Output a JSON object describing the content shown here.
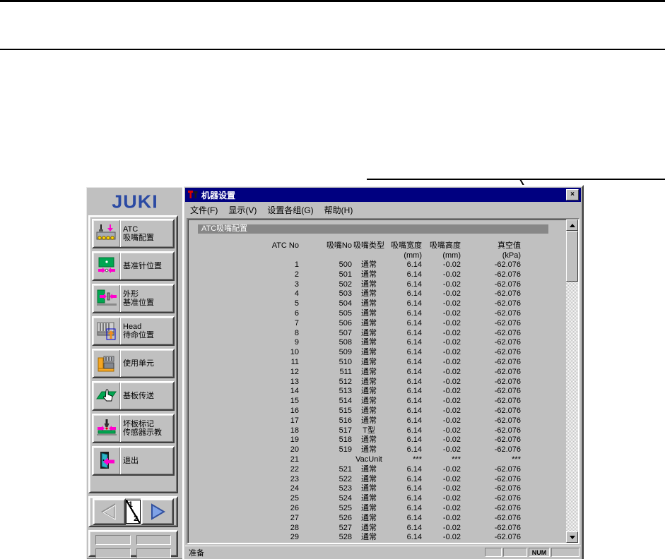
{
  "sidebar": {
    "logo": "JUKI",
    "buttons": [
      {
        "line1": "ATC",
        "line2": "吸嘴配置"
      },
      {
        "line1": "基准针位置",
        "line2": ""
      },
      {
        "line1": "外形",
        "line2": "基准位置"
      },
      {
        "line1": "Head",
        "line2": "待命位置"
      },
      {
        "line1": "使用单元",
        "line2": ""
      },
      {
        "line1": "基板传送",
        "line2": ""
      },
      {
        "line1": "坏板标记",
        "line2": "传感器示教"
      },
      {
        "line1": "退出",
        "line2": ""
      }
    ],
    "pager": {
      "current": "1",
      "total": "2"
    }
  },
  "window": {
    "title": "机器设置",
    "close_glyph": "×",
    "menu": [
      "文件(F)",
      "显示(V)",
      "设置各组(G)",
      "帮助(H)"
    ],
    "section_header": "ATC吸嘴配置",
    "table": {
      "headers": [
        "ATC No",
        "吸嘴No",
        "吸嘴类型",
        "吸嘴宽度",
        "吸嘴高度",
        "真空值"
      ],
      "units": [
        "",
        "",
        "",
        "(mm)",
        "(mm)",
        "(kPa)"
      ],
      "rows": [
        [
          "1",
          "500",
          "通常",
          "6.14",
          "-0.02",
          "-62.076"
        ],
        [
          "2",
          "501",
          "通常",
          "6.14",
          "-0.02",
          "-62.076"
        ],
        [
          "3",
          "502",
          "通常",
          "6.14",
          "-0.02",
          "-62.076"
        ],
        [
          "4",
          "503",
          "通常",
          "6.14",
          "-0.02",
          "-62.076"
        ],
        [
          "5",
          "504",
          "通常",
          "6.14",
          "-0.02",
          "-62.076"
        ],
        [
          "6",
          "505",
          "通常",
          "6.14",
          "-0.02",
          "-62.076"
        ],
        [
          "7",
          "506",
          "通常",
          "6.14",
          "-0.02",
          "-62.076"
        ],
        [
          "8",
          "507",
          "通常",
          "6.14",
          "-0.02",
          "-62.076"
        ],
        [
          "9",
          "508",
          "通常",
          "6.14",
          "-0.02",
          "-62.076"
        ],
        [
          "10",
          "509",
          "通常",
          "6.14",
          "-0.02",
          "-62.076"
        ],
        [
          "11",
          "510",
          "通常",
          "6.14",
          "-0.02",
          "-62.076"
        ],
        [
          "12",
          "511",
          "通常",
          "6.14",
          "-0.02",
          "-62.076"
        ],
        [
          "13",
          "512",
          "通常",
          "6.14",
          "-0.02",
          "-62.076"
        ],
        [
          "14",
          "513",
          "通常",
          "6.14",
          "-0.02",
          "-62.076"
        ],
        [
          "15",
          "514",
          "通常",
          "6.14",
          "-0.02",
          "-62.076"
        ],
        [
          "16",
          "515",
          "通常",
          "6.14",
          "-0.02",
          "-62.076"
        ],
        [
          "17",
          "516",
          "通常",
          "6.14",
          "-0.02",
          "-62.076"
        ],
        [
          "18",
          "517",
          "T型",
          "6.14",
          "-0.02",
          "-62.076"
        ],
        [
          "19",
          "518",
          "通常",
          "6.14",
          "-0.02",
          "-62.076"
        ],
        [
          "20",
          "519",
          "通常",
          "6.14",
          "-0.02",
          "-62.076"
        ],
        [
          "21",
          "",
          "VacUnit",
          "***",
          "***",
          "***"
        ],
        [
          "22",
          "521",
          "通常",
          "6.14",
          "-0.02",
          "-62.076"
        ],
        [
          "23",
          "522",
          "通常",
          "6.14",
          "-0.02",
          "-62.076"
        ],
        [
          "24",
          "523",
          "通常",
          "6.14",
          "-0.02",
          "-62.076"
        ],
        [
          "25",
          "524",
          "通常",
          "6.14",
          "-0.02",
          "-62.076"
        ],
        [
          "26",
          "525",
          "通常",
          "6.14",
          "-0.02",
          "-62.076"
        ],
        [
          "27",
          "526",
          "通常",
          "6.14",
          "-0.02",
          "-62.076"
        ],
        [
          "28",
          "527",
          "通常",
          "6.14",
          "-0.02",
          "-62.076"
        ],
        [
          "29",
          "528",
          "通常",
          "6.14",
          "-0.02",
          "-62.076"
        ]
      ]
    },
    "statusbar": {
      "ready": "准备",
      "num": "NUM"
    }
  },
  "colors": {
    "titlebar": "#000080",
    "silver": "#c0c0c0",
    "section_bar": "#878787",
    "juki_blue": "#2b4aa3",
    "arrow_magenta": "#ff00cc",
    "board_green": "#00a651",
    "door_teal": "#2ab4c8",
    "unit_orange": "#f5a623",
    "nozzle_yellow": "#ffd800"
  }
}
